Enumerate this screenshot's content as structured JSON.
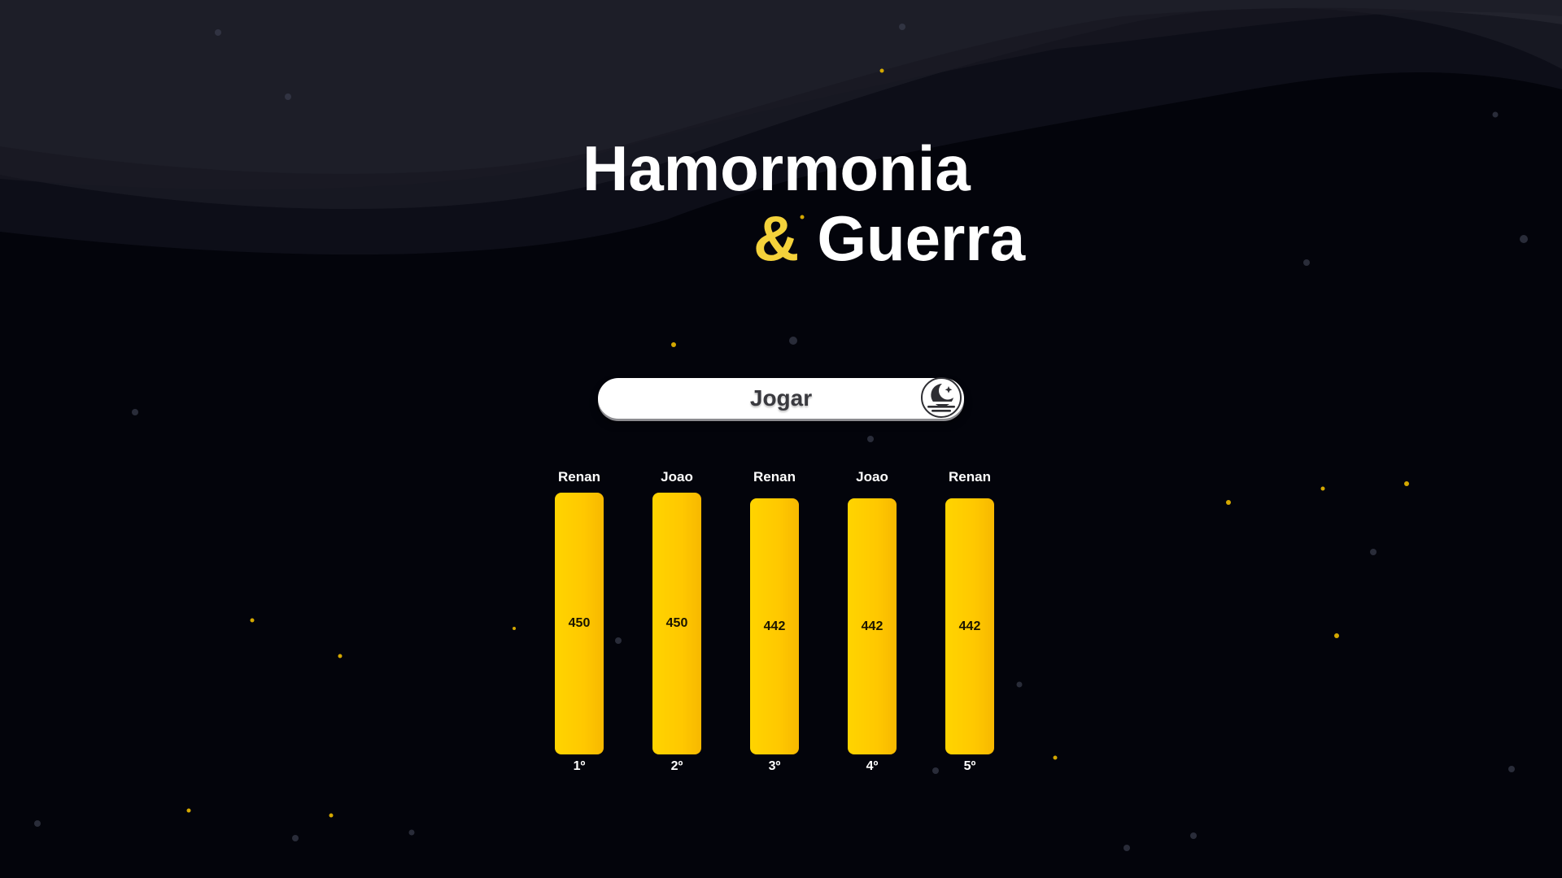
{
  "title": {
    "line1": "Hamormonia",
    "ampersand": "&",
    "line2": "Guerra"
  },
  "play_button": {
    "label": "Jogar",
    "icon": "moon-sunset-icon"
  },
  "ranking": [
    {
      "name": "Renan",
      "score": "450",
      "position": "1º"
    },
    {
      "name": "Joao",
      "score": "450",
      "position": "2º"
    },
    {
      "name": "Renan",
      "score": "442",
      "position": "3º"
    },
    {
      "name": "Joao",
      "score": "442",
      "position": "4º"
    },
    {
      "name": "Renan",
      "score": "442",
      "position": "5º"
    }
  ],
  "colors": {
    "background": "#03040b",
    "accent": "#f4d23b",
    "bar": "#ffc800",
    "button": "#ffffff"
  }
}
